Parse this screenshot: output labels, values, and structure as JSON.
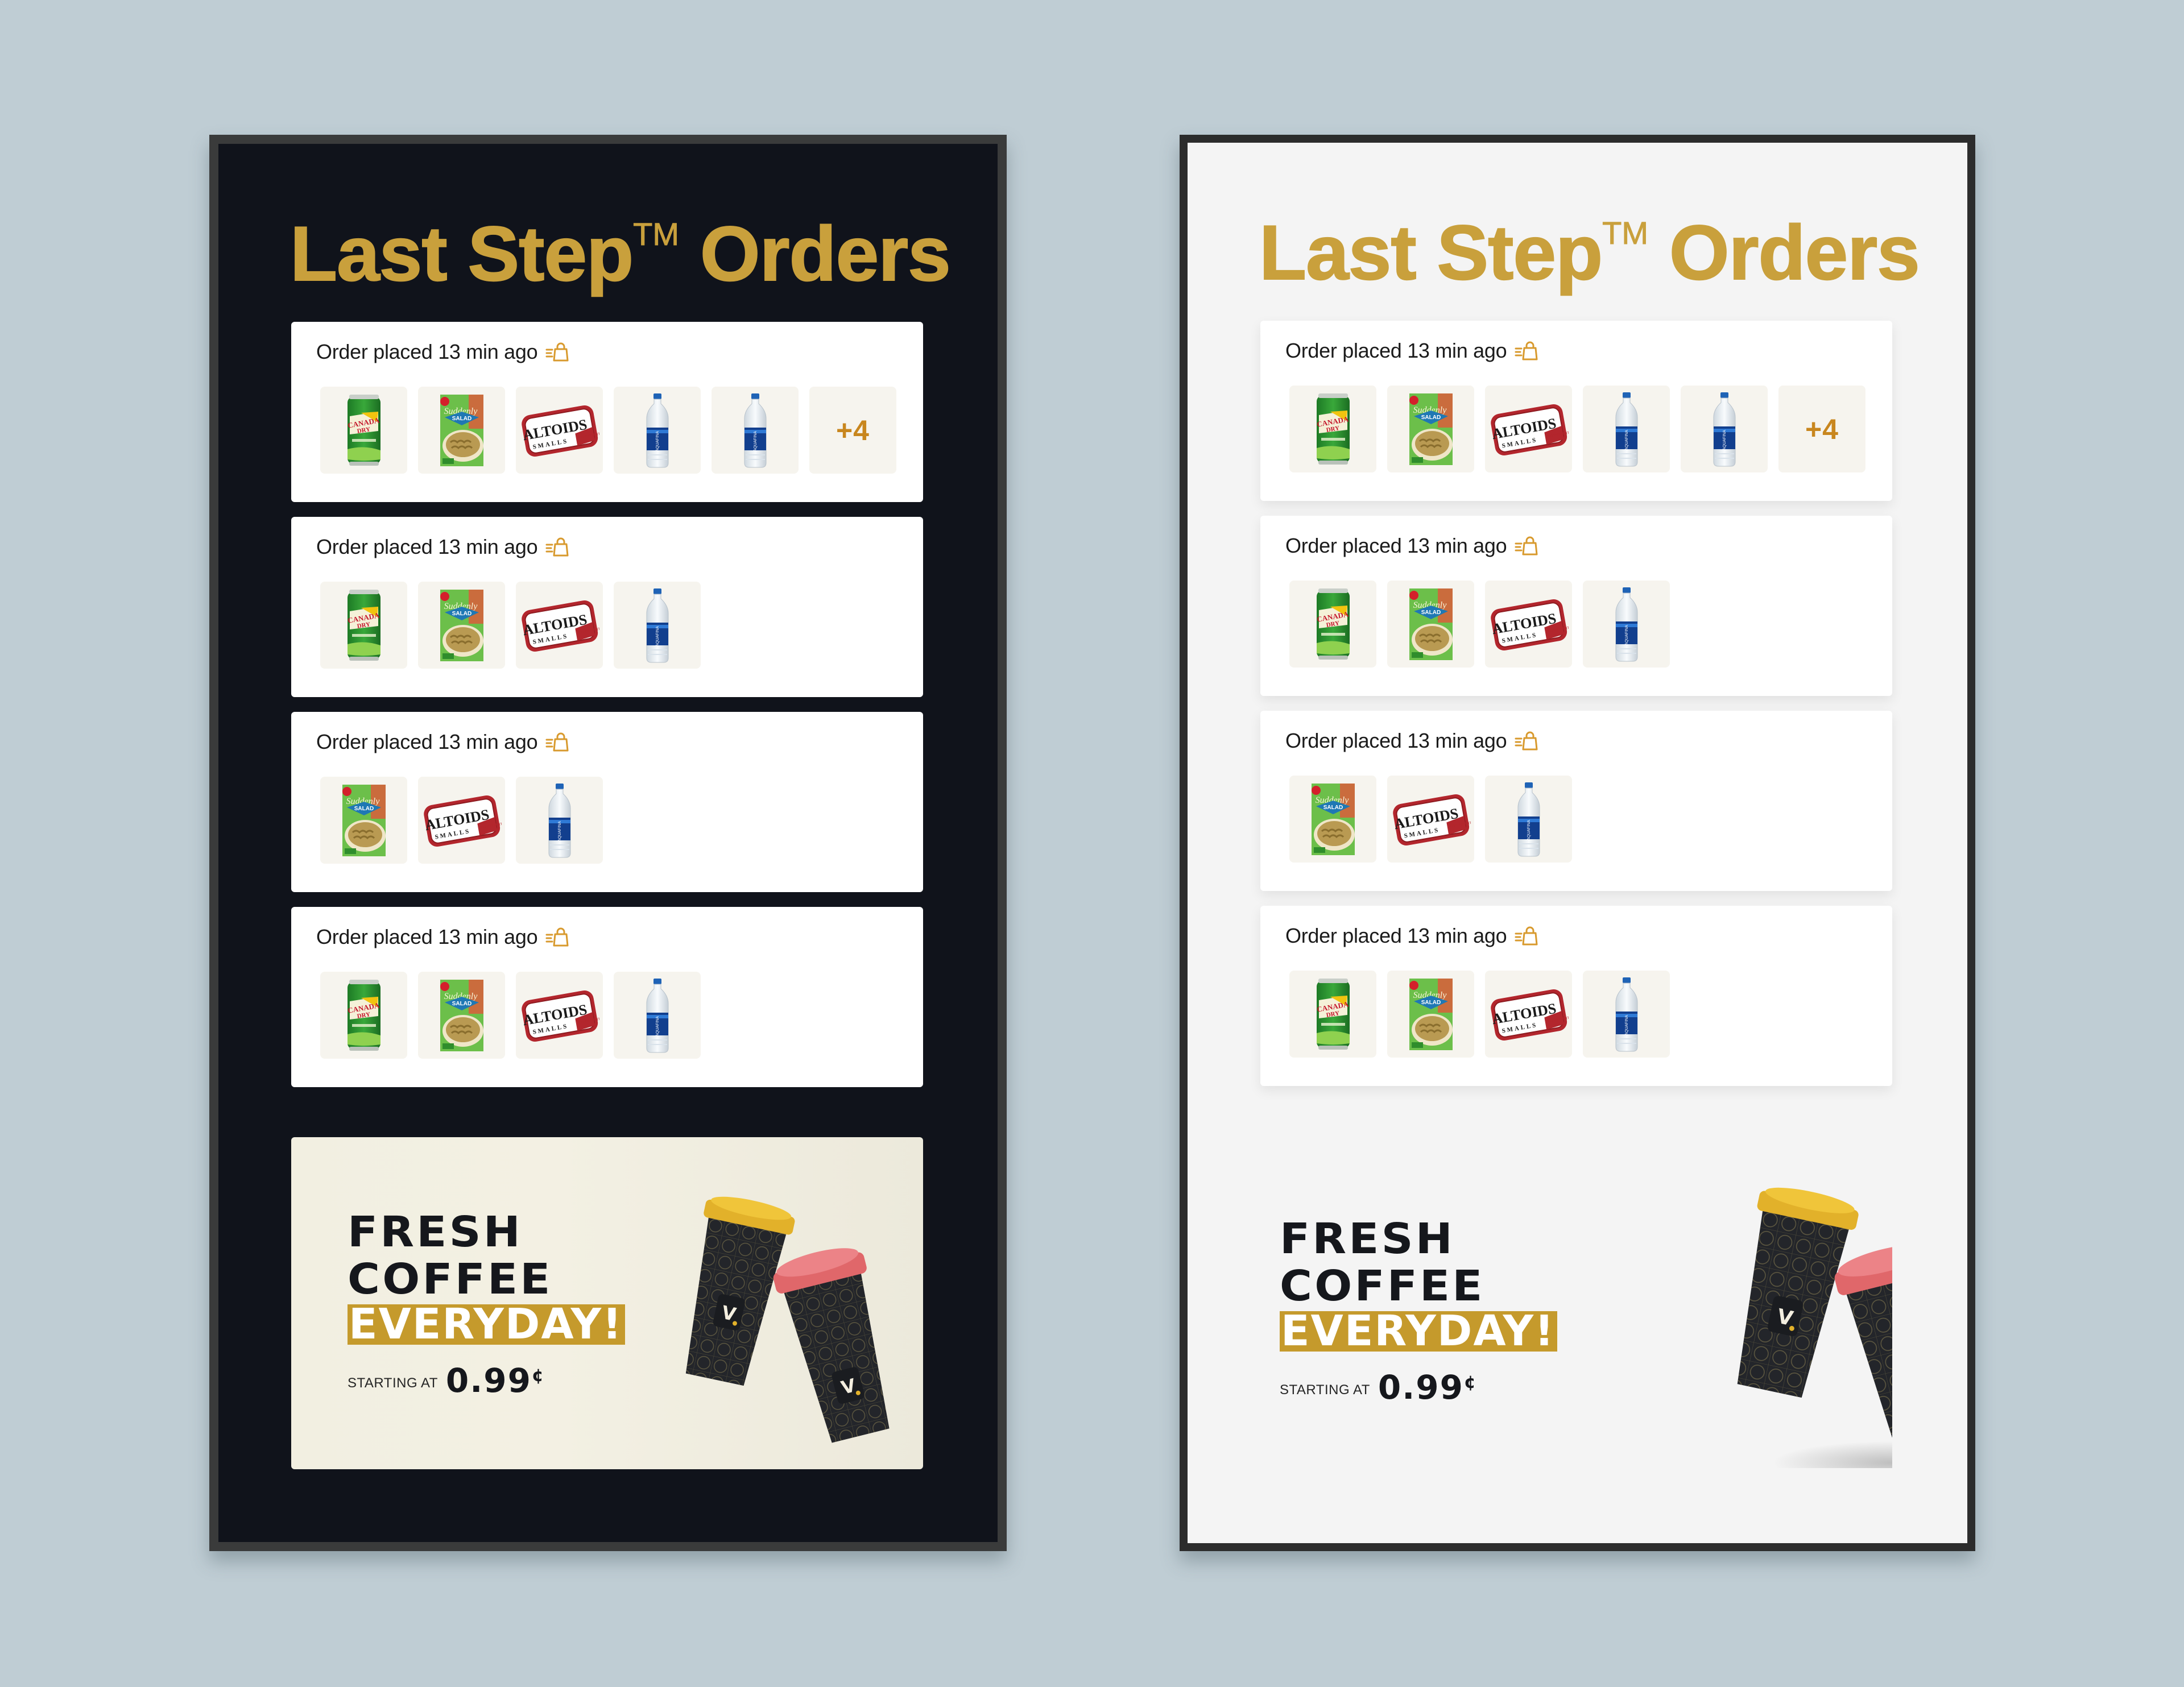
{
  "screens": [
    {
      "theme": "dark",
      "title": "Last Step",
      "trademark": "TM",
      "title_suffix": "Orders",
      "orders": [
        {
          "status": "Order placed 13 min ago",
          "icon": "fast-shopping-bag-icon",
          "items": [
            "canada-dry-ginger-ale",
            "suddenly-salad",
            "altoids-smalls",
            "aquafina-water",
            "aquafina-water"
          ],
          "more": "+4"
        },
        {
          "status": "Order placed 13 min ago",
          "icon": "fast-shopping-bag-icon",
          "items": [
            "canada-dry-ginger-ale",
            "suddenly-salad",
            "altoids-smalls",
            "aquafina-water"
          ],
          "more": null
        },
        {
          "status": "Order placed 13 min ago",
          "icon": "fast-shopping-bag-icon",
          "items": [
            "suddenly-salad",
            "altoids-smalls",
            "aquafina-water"
          ],
          "more": null
        },
        {
          "status": "Order placed 13 min ago",
          "icon": "fast-shopping-bag-icon",
          "items": [
            "canada-dry-ginger-ale",
            "suddenly-salad",
            "altoids-smalls",
            "aquafina-water"
          ],
          "more": null
        }
      ],
      "promo": {
        "line1": "FRESH",
        "line2": "COFFEE",
        "highlight": "EVERYDAY!",
        "starting_label": "STARTING AT",
        "price": "0.99",
        "currency": "¢"
      }
    },
    {
      "theme": "light",
      "title": "Last Step",
      "trademark": "TM",
      "title_suffix": "Orders",
      "orders": [
        {
          "status": "Order placed 13 min ago",
          "icon": "fast-shopping-bag-icon",
          "items": [
            "canada-dry-ginger-ale",
            "suddenly-salad",
            "altoids-smalls",
            "aquafina-water",
            "aquafina-water"
          ],
          "more": "+4"
        },
        {
          "status": "Order placed 13 min ago",
          "icon": "fast-shopping-bag-icon",
          "items": [
            "canada-dry-ginger-ale",
            "suddenly-salad",
            "altoids-smalls",
            "aquafina-water"
          ],
          "more": null
        },
        {
          "status": "Order placed 13 min ago",
          "icon": "fast-shopping-bag-icon",
          "items": [
            "suddenly-salad",
            "altoids-smalls",
            "aquafina-water"
          ],
          "more": null
        },
        {
          "status": "Order placed 13 min ago",
          "icon": "fast-shopping-bag-icon",
          "items": [
            "canada-dry-ginger-ale",
            "suddenly-salad",
            "altoids-smalls",
            "aquafina-water"
          ],
          "more": null
        }
      ],
      "promo": {
        "line1": "FRESH",
        "line2": "COFFEE",
        "highlight": "EVERYDAY!",
        "starting_label": "STARTING AT",
        "price": "0.99",
        "currency": "¢"
      }
    }
  ],
  "colors": {
    "background": "#bfcdd4",
    "gold": "#c9a03c",
    "accent_orange": "#c8861e",
    "promo_gold": "#c59a2c",
    "dark_screen": "#10131b",
    "light_screen": "#f4f4f4",
    "cup_lid_yellow": "#e2b12a",
    "cup_lid_red": "#e0676a"
  }
}
